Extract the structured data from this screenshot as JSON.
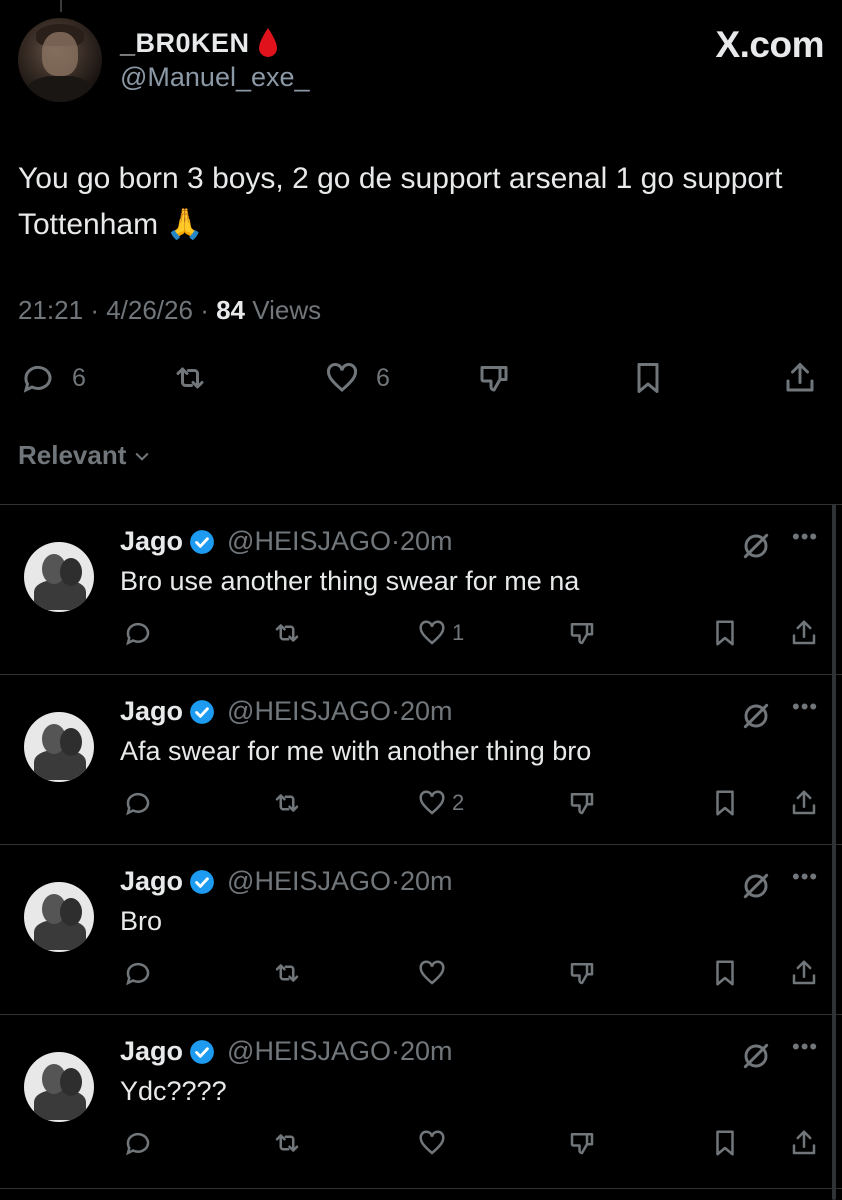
{
  "tweet": {
    "display_name": "_BR0KEN",
    "handle": "@Manuel_exe_",
    "brand": "X.com",
    "text": "You go born 3 boys, 2 go de support arsenal 1 go support Tottenham 🙏",
    "time": "21:21",
    "date": "4/26/26",
    "views_count": "84",
    "views_label": "Views",
    "reply_count": "6",
    "like_count": "6",
    "drop_color": "#e0131c"
  },
  "sort": {
    "label": "Relevant"
  },
  "colors": {
    "muted": "#71767b",
    "verified": "#1d9bf0",
    "text": "#e7e9ea"
  },
  "replies": [
    {
      "name": "Jago",
      "handle": "@HEISJAGO",
      "time": "20m",
      "text": "Bro use another thing swear for me na",
      "likes": "1"
    },
    {
      "name": "Jago",
      "handle": "@HEISJAGO",
      "time": "20m",
      "text": "Afa swear for me with another thing bro",
      "likes": "2"
    },
    {
      "name": "Jago",
      "handle": "@HEISJAGO",
      "time": "20m",
      "text": "Bro",
      "likes": ""
    },
    {
      "name": "Jago",
      "handle": "@HEISJAGO",
      "time": "20m",
      "text": "Ydc????",
      "likes": ""
    }
  ]
}
